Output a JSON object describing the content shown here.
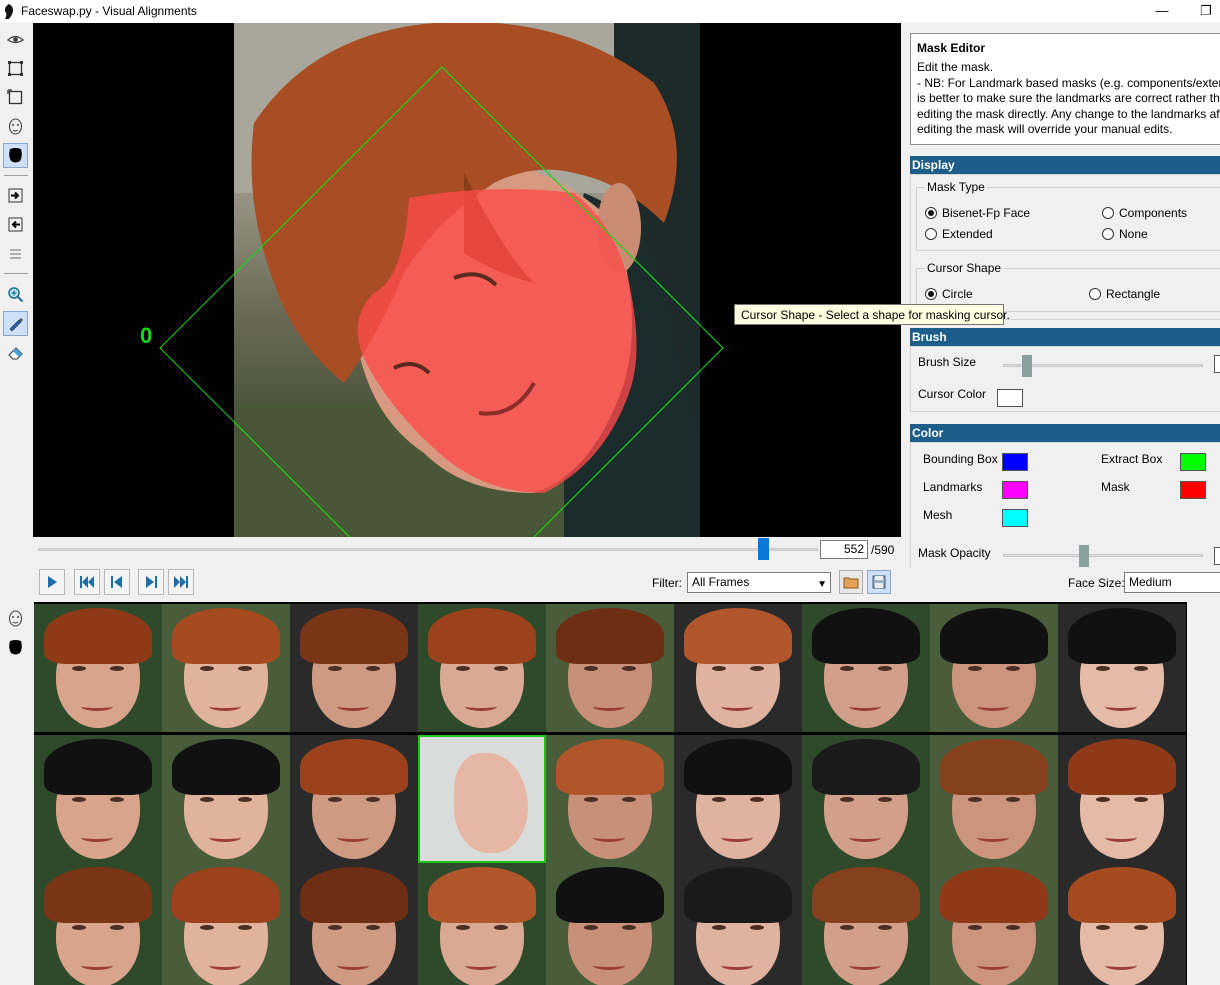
{
  "window": {
    "title": "Faceswap.py - Visual Alignments",
    "minimize_glyph": "—",
    "restore_glyph": "❐"
  },
  "toolbar": {
    "tools": [
      {
        "name": "view-icon",
        "active": false
      },
      {
        "name": "bounding-box-icon",
        "active": false
      },
      {
        "name": "extract-box-icon",
        "active": false
      },
      {
        "name": "landmarks-icon",
        "active": false
      },
      {
        "name": "mask-icon",
        "active": true
      },
      {
        "name": "copy-next-icon",
        "active": false
      },
      {
        "name": "copy-prev-icon",
        "active": false
      },
      {
        "name": "revert-icon",
        "active": false
      },
      {
        "name": "zoom-icon",
        "active": false
      },
      {
        "name": "brush-icon",
        "active": true
      },
      {
        "name": "eraser-icon",
        "active": false
      }
    ]
  },
  "canvas": {
    "face_number": "0"
  },
  "navigation": {
    "frame_current": "552",
    "frame_total": "/590",
    "frame_progress": 0.936,
    "filter_label": "Filter:",
    "filter_value": "All Frames",
    "face_size_label": "Face Size:",
    "face_size_value": "Medium"
  },
  "help": {
    "title": "Mask Editor",
    "lines": [
      "Edit the mask.",
      " - NB: For Landmark based masks (e.g. components/extended) it",
      "is better to make sure the landmarks are correct rather than",
      "editing the mask directly. Any change to the landmarks after",
      "editing the mask will override your manual edits."
    ]
  },
  "display": {
    "header": "Display",
    "mask_type_title": "Mask Type",
    "mask_types": [
      {
        "label": "Bisenet-Fp Face",
        "selected": true
      },
      {
        "label": "Components",
        "selected": false
      },
      {
        "label": "Extended",
        "selected": false
      },
      {
        "label": "None",
        "selected": false
      }
    ],
    "cursor_shape_title": "Cursor Shape",
    "cursor_shapes": [
      {
        "label": "Circle",
        "selected": true
      },
      {
        "label": "Rectangle",
        "selected": false
      }
    ]
  },
  "tooltip": "Cursor Shape - Select a shape for masking cursor.",
  "brush": {
    "header": "Brush",
    "size_label": "Brush Size",
    "size_level": 0.1,
    "cursor_color_label": "Cursor Color",
    "cursor_color": "#ffffff"
  },
  "color": {
    "header": "Color",
    "items": [
      {
        "label": "Bounding Box",
        "color": "#0000ff"
      },
      {
        "label": "Extract Box",
        "color": "#00ff00"
      },
      {
        "label": "Landmarks",
        "color": "#ff00ff"
      },
      {
        "label": "Mask",
        "color": "#ff0000"
      },
      {
        "label": "Mesh",
        "color": "#00ffff"
      }
    ],
    "opacity_label": "Mask Opacity",
    "opacity_level": 0.4
  },
  "colors": {
    "accent_blue": "#0a78d7",
    "section_header": "#1d5d8a",
    "mask_overlay": "#ff4a4a",
    "extract_box": "#16d816"
  }
}
